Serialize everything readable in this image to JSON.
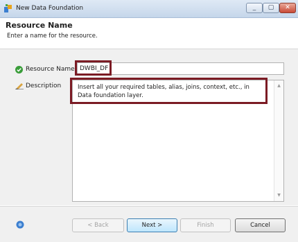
{
  "window": {
    "title": "New Data Foundation",
    "controls": {
      "minimize": "▭",
      "maximize": "▢",
      "close": "✕"
    }
  },
  "header": {
    "title": "Resource Name",
    "subtitle": "Enter a name for the resource."
  },
  "form": {
    "resource_name_label": "Resource Name",
    "resource_name_value": "DWBI_DF",
    "description_label": "Description",
    "description_value": "Insert all your required tables, alias, joins, context, etc., in Data foundation layer."
  },
  "footer": {
    "back": "< Back",
    "next": "Next >",
    "finish": "Finish",
    "cancel": "Cancel"
  },
  "colors": {
    "highlight": "#7b1b24",
    "titlebar": "#c5d6ea",
    "ok_icon": "#3a9d3a",
    "help_icon": "#3c7fd0"
  },
  "icons": [
    "app-icon",
    "check-icon",
    "pencil-icon",
    "help-icon"
  ]
}
